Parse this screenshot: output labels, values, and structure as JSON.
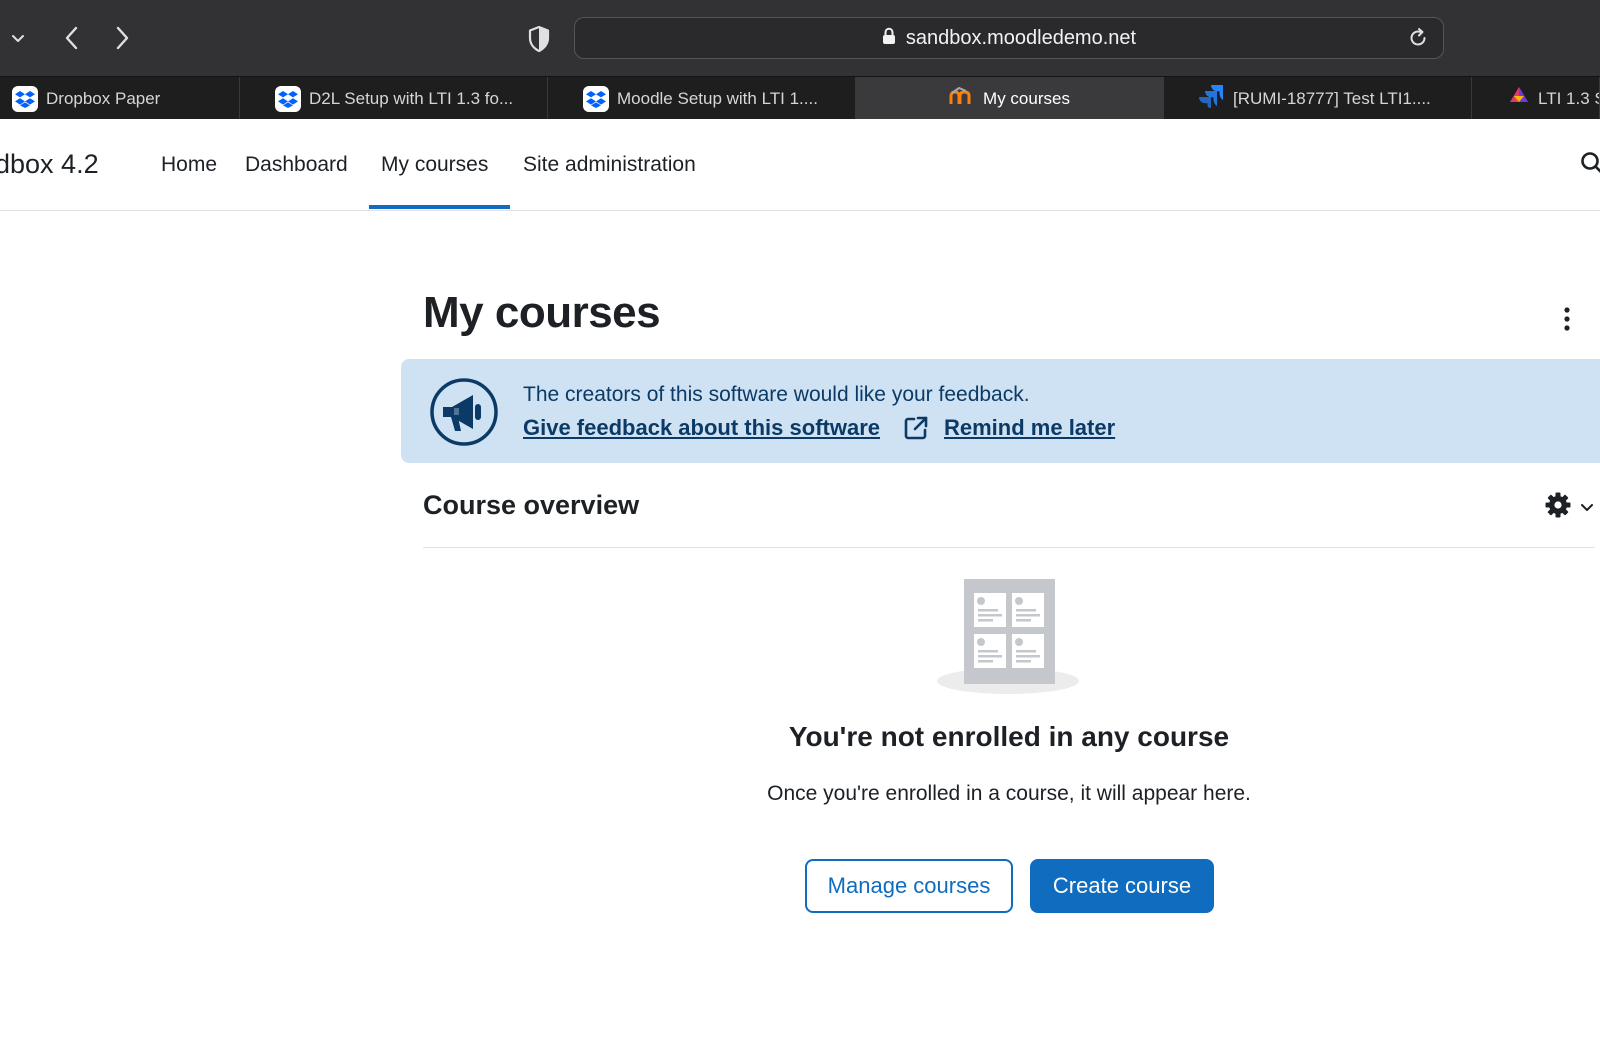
{
  "browser": {
    "url": "sandbox.moodledemo.net",
    "tabs": [
      {
        "label": "Dropbox Paper",
        "icon": "dropbox-icon"
      },
      {
        "label": "D2L Setup with LTI 1.3 fo...",
        "icon": "dropbox-icon"
      },
      {
        "label": "Moodle Setup with LTI 1....",
        "icon": "dropbox-icon"
      },
      {
        "label": "My courses",
        "icon": "moodle-icon",
        "active": true
      },
      {
        "label": "[RUMI-18777] Test LTI1....",
        "icon": "jira-icon"
      },
      {
        "label": "LTI 1.3 S",
        "icon": "kritik-icon"
      }
    ]
  },
  "nav": {
    "brand": "dbox 4.2",
    "links": [
      "Home",
      "Dashboard",
      "My courses",
      "Site administration"
    ],
    "active": "My courses"
  },
  "page": {
    "title": "My courses"
  },
  "feedback": {
    "message": "The creators of this software would like your feedback.",
    "give_feedback": "Give feedback about this software",
    "remind_later": "Remind me later"
  },
  "overview": {
    "title": "Course overview",
    "empty_heading": "You're not enrolled in any course",
    "empty_text": "Once you're enrolled in a course, it will appear here.",
    "manage_label": "Manage courses",
    "create_label": "Create course"
  },
  "colors": {
    "primary": "#0f6cbf",
    "alert_bg": "#cfe2f3",
    "alert_text": "#0b3a66"
  }
}
